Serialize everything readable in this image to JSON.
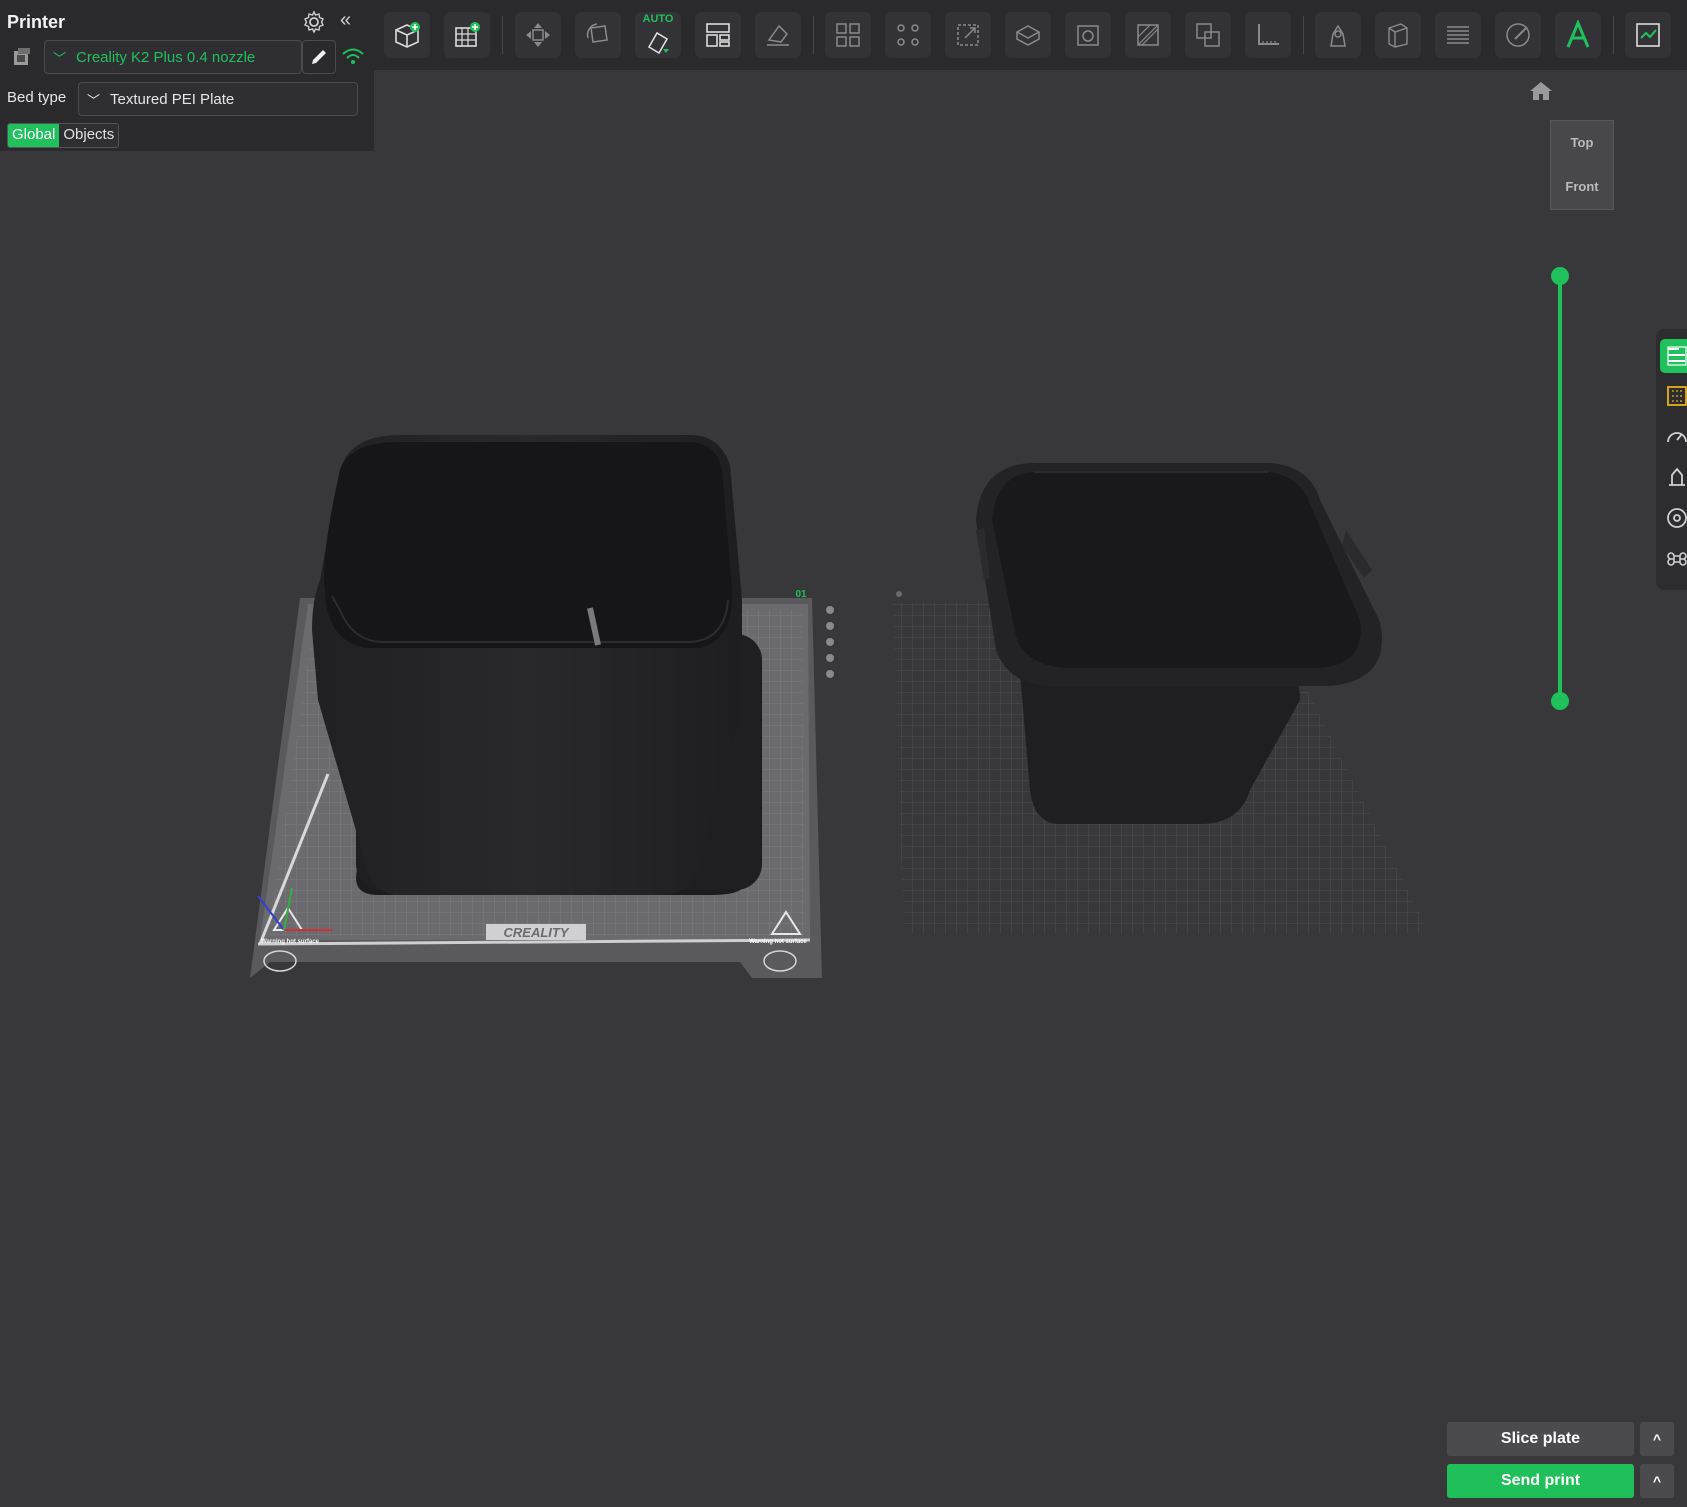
{
  "panel": {
    "title": "Printer",
    "printer_name": "Creality K2 Plus 0.4 nozzle",
    "bed_type_label": "Bed type",
    "bed_type_value": "Textured PEI Plate",
    "tabs": [
      {
        "label": "Global",
        "active": true
      },
      {
        "label": "Objects",
        "active": false
      }
    ]
  },
  "toolbar": {
    "auto_label": "AUTO",
    "buttons": [
      "add-object-icon",
      "add-plate-icon",
      "move-icon",
      "rotate-icon",
      "auto-orient-icon",
      "arrange-icon",
      "lay-on-face-icon",
      "split-objects-icon",
      "split-parts-icon",
      "scale-icon",
      "cut-icon",
      "hollow-icon",
      "support-paint-icon",
      "boolean-icon",
      "measure-icon",
      "seam-paint-icon",
      "variable-layer-icon",
      "layer-settings-icon",
      "color-paint-icon",
      "text-icon",
      "assembly-icon"
    ]
  },
  "scene": {
    "bed_brand": "CREALITY",
    "plate_number": "01",
    "warning_text": "Warning hot surface"
  },
  "view_cube": {
    "top": "Top",
    "front": "Front"
  },
  "actions": {
    "slice": "Slice plate",
    "send": "Send print",
    "caret": "^"
  },
  "colors": {
    "accent": "#20c05c",
    "panel_bg": "#2a2a2d",
    "viewport_bg": "#38383b"
  }
}
